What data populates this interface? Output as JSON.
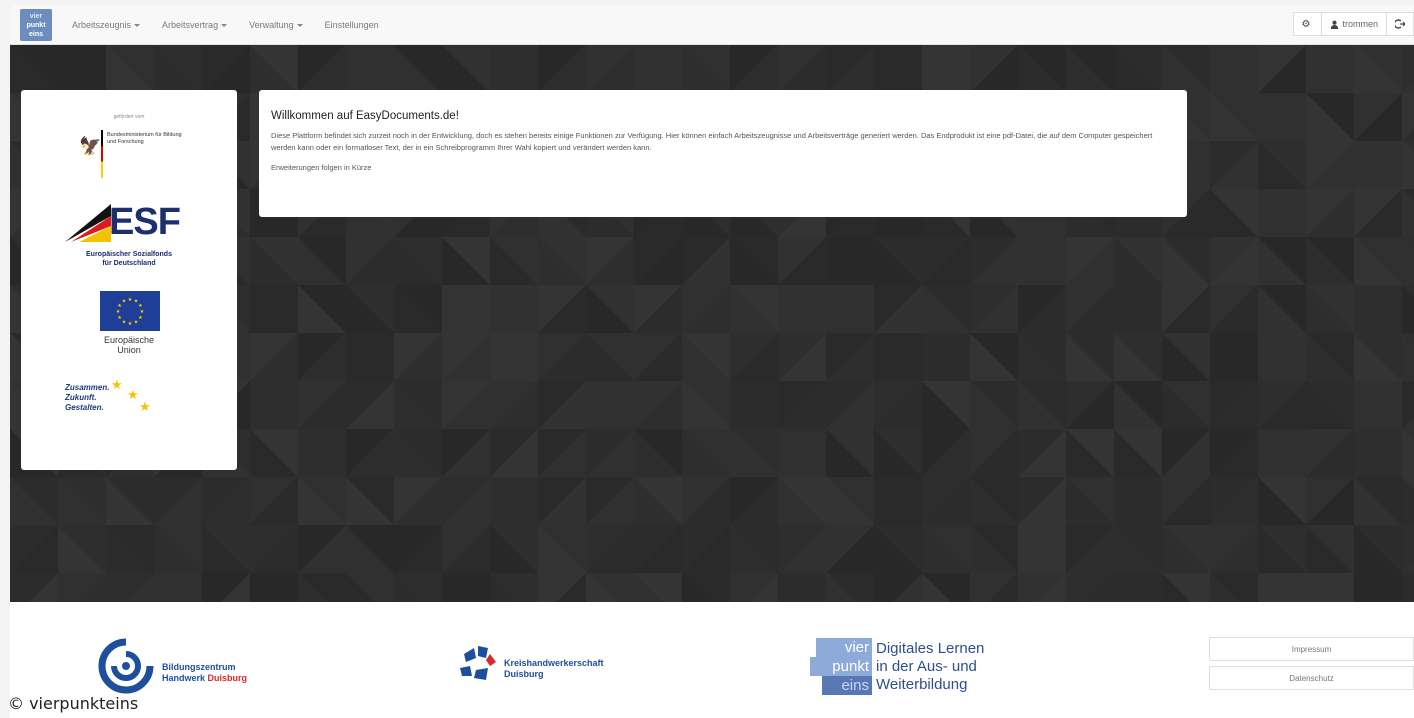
{
  "navbar": {
    "brand": {
      "line1": "vier",
      "line2": "punkt",
      "line3": "eins"
    },
    "items": [
      {
        "label": "Arbeitszeugnis",
        "dropdown": true
      },
      {
        "label": "Arbeitsvertrag",
        "dropdown": true
      },
      {
        "label": "Verwaltung",
        "dropdown": true
      },
      {
        "label": "Einstellungen",
        "dropdown": false
      }
    ],
    "user": "trommen"
  },
  "sponsors": {
    "bmbf_subtitle": "gefördert vom",
    "bmbf_text": "Bundesministerium für Bildung und Forschung",
    "esf_logo": "ESF",
    "esf_line1": "Europäischer Sozialfonds",
    "esf_line2": "für Deutschland",
    "eu_line1": "Europäische",
    "eu_line2": "Union",
    "slogan_line1": "Zusammen.",
    "slogan_line2": "Zukunft.",
    "slogan_line3": "Gestalten."
  },
  "welcome": {
    "title": "Willkommen auf EasyDocuments.de!",
    "text": "Diese Plattform befindet sich zurzeit noch in der Entwicklung, doch es stehen bereits einige Funktionen zur Verfügung. Hier können einfach Arbeitszeugnisse und Arbeitsverträge generiert werden. Das Endprodukt ist eine pdf-Datei, die auf dem Computer gespeichert werden kann oder ein formatloser Text, der in ein Schreibprogramm Ihrer Wahl kopiert und verändert werden kann.",
    "more": "Erweiterungen folgen in Kürze"
  },
  "footer": {
    "bzh_line1": "Bildungszentrum",
    "bzh_line2a": "Handwerk",
    "bzh_line2b": "Duisburg",
    "khw_line1": "Kreishandwerkerschaft",
    "khw_line2": "Duisburg",
    "vpe_badge": {
      "line1": "vier",
      "line2": "punkt",
      "line3": "eins"
    },
    "vpe_line1": "Digitales Lernen",
    "vpe_line2": "in der Aus- und",
    "vpe_line3": "Weiterbildung",
    "links": [
      "Impressum",
      "Datenschutz"
    ]
  },
  "copyright": "© vierpunkteins",
  "colors": {
    "accent": "#6c8ebf",
    "hero_bg": "#2d2d2d",
    "brand_blue": "#1e4f9c"
  }
}
